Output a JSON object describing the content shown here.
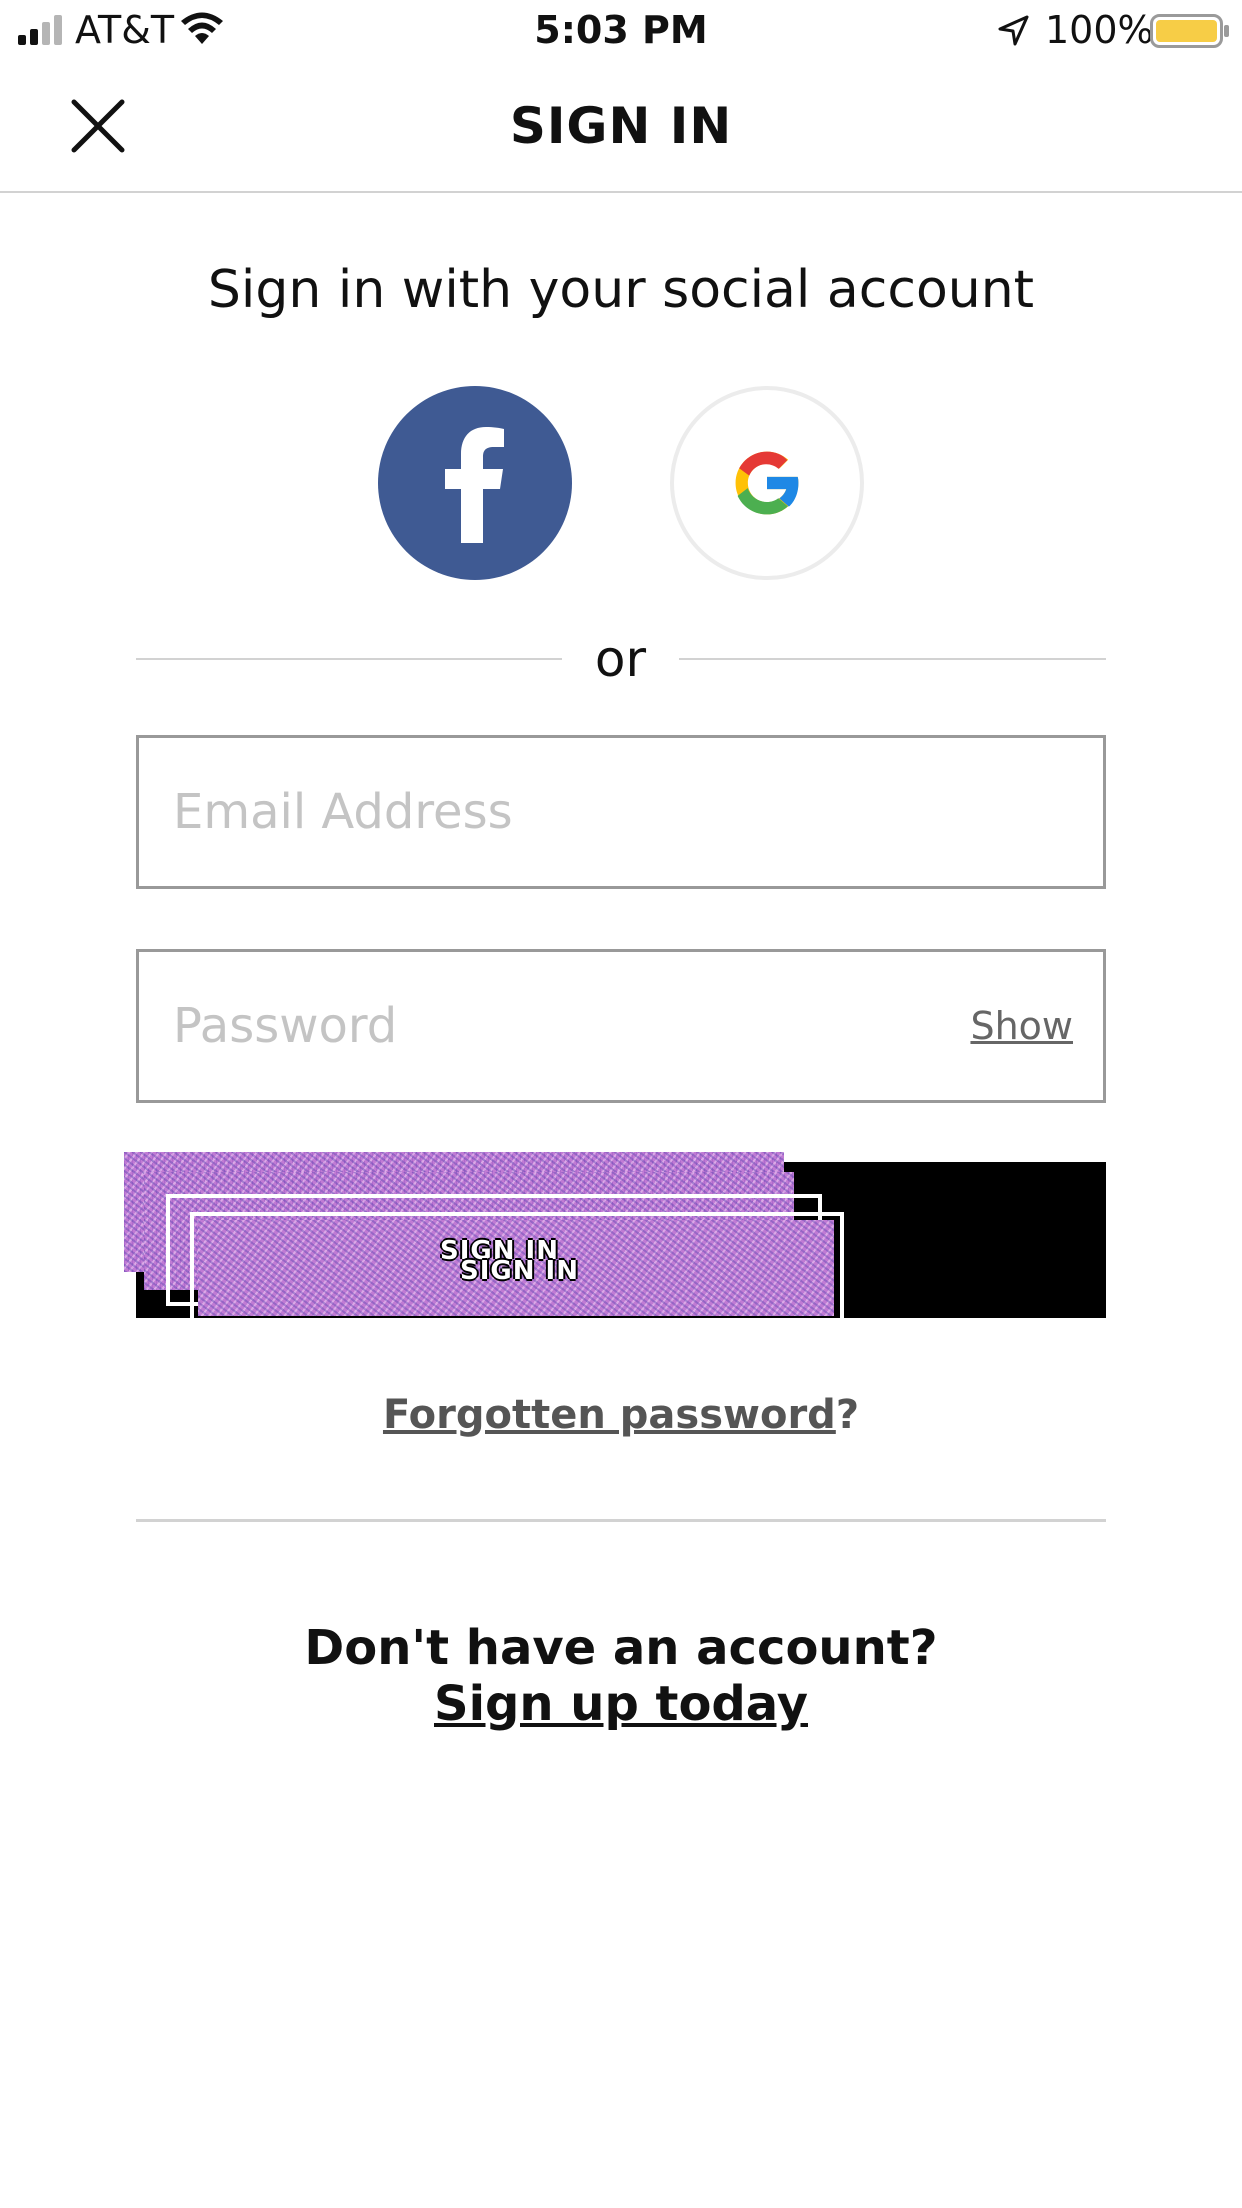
{
  "status_bar": {
    "carrier": "AT&T",
    "time": "5:03 PM",
    "battery_percent": "100%",
    "battery_level": 1.0,
    "signal_bars": 2,
    "signal_bars_total": 4,
    "icons": [
      "signal-icon",
      "wifi-icon",
      "location-arrow-icon",
      "battery-icon"
    ],
    "battery_color": "#f7cd46"
  },
  "nav": {
    "title": "SIGN IN",
    "close_icon": "close-icon"
  },
  "social": {
    "heading": "Sign in with your social account",
    "providers": [
      {
        "name": "facebook",
        "icon": "facebook-icon",
        "color": "#3f5a93"
      },
      {
        "name": "google",
        "icon": "google-icon",
        "color": "#ffffff"
      }
    ]
  },
  "divider": {
    "text": "or"
  },
  "form": {
    "email_placeholder": "Email Address",
    "email_value": "",
    "password_placeholder": "Password",
    "password_value": "",
    "show_label": "Show",
    "submit_label": "SIGN IN",
    "submit_label_ghost": "SIGN IN"
  },
  "forgot": {
    "link_text": "Forgotten password",
    "suffix": "?"
  },
  "signup": {
    "prompt": "Don't have an account?",
    "link_text": "Sign up today"
  },
  "colors": {
    "text": "#111111",
    "muted_link": "#555555",
    "placeholder": "#c4c4c4",
    "divider": "#d2d2d2",
    "input_border": "#999999",
    "button_bg": "#000000",
    "glitch": "#c07bd4"
  }
}
